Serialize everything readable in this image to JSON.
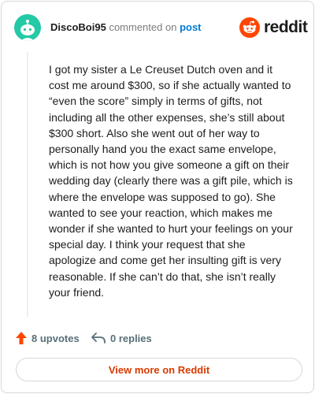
{
  "comment": {
    "author": "DiscoBoi95",
    "commented_on": "commented on",
    "post_link": "post",
    "body": "I got my sister a Le Creuset Dutch oven and it cost me around $300, so if she actually wanted to “even the score” simply in terms of gifts, not including all the other expenses, she’s still about $300 short. Also she went out of her way to personally hand you the exact same envelope, which is not how you give someone a gift on their wedding day (clearly there was a gift pile, which is where the envelope was supposed to go). She wanted to see your reaction, which makes me wonder if she wanted to hurt your feelings on your special day. I think your request that she apologize and come get her insulting gift is very reasonable. If she can’t do that, she isn’t really your friend."
  },
  "brand": {
    "name": "reddit"
  },
  "actions": {
    "upvotes_label": "8 upvotes",
    "replies_label": "0 replies"
  },
  "footer": {
    "view_more_label": "View more on Reddit"
  },
  "colors": {
    "avatar": "#24c9a6",
    "reddit_orange": "#ff4500",
    "link_blue": "#0079d3",
    "cta_text": "#d93a00"
  },
  "icons": {
    "avatar": "snoo-avatar-icon",
    "brand": "reddit-logo-icon",
    "upvote": "upvote-arrow-icon",
    "reply": "reply-arrow-icon"
  }
}
